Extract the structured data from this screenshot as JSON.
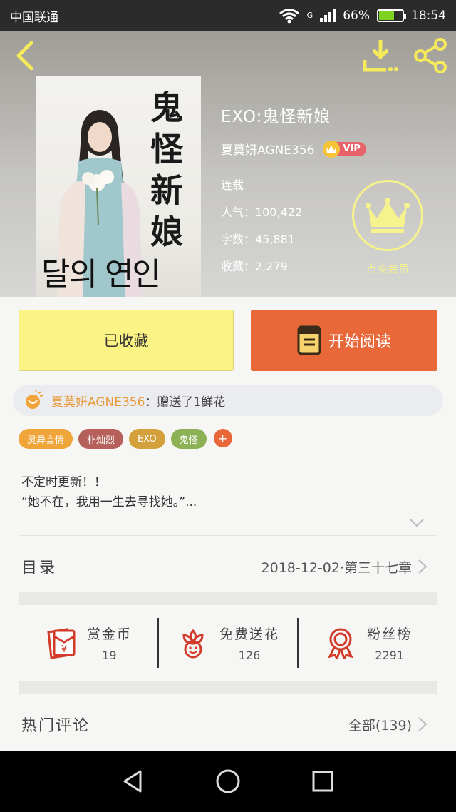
{
  "status_bar": {
    "carrier": "中国联通",
    "network": "G",
    "battery": "66%",
    "battery_level": 0.66,
    "time": "18:54"
  },
  "book": {
    "title": "EXO:鬼怪新娘",
    "author": "夏莫妍AGNE356",
    "vip_badge": "VIP",
    "status": "连载",
    "popularity": "人气：100,422",
    "word_count": "字数：45,881",
    "favorites": "收藏：2,279",
    "cover": {
      "title_chars": [
        "鬼",
        "怪",
        "新",
        "娘"
      ],
      "korean_text": "달의 연인"
    }
  },
  "member": {
    "label": "点亮会员"
  },
  "actions": {
    "collected": "已收藏",
    "start_reading": "开始阅读"
  },
  "gift": {
    "user": "夏莫妍AGNE356",
    "text": "：赠送了1鲜花"
  },
  "tags": [
    {
      "label": "灵异言情",
      "color": "#f0a53a"
    },
    {
      "label": "朴灿烈",
      "color": "#b5605a"
    },
    {
      "label": "EXO",
      "color": "#d4a03c"
    },
    {
      "label": "鬼怪",
      "color": "#8db255"
    }
  ],
  "tag_add": "+",
  "description": {
    "line1": "不定时更新！！",
    "line2": "“她不在，我用一生去寻找她。”..."
  },
  "toc": {
    "label": "目录",
    "latest": "2018-12-02·第三十七章"
  },
  "stats": [
    {
      "label": "赏金币",
      "value": "19",
      "icon": "red-envelope-icon"
    },
    {
      "label": "免费送花",
      "value": "126",
      "icon": "flower-icon"
    },
    {
      "label": "粉丝榜",
      "value": "2291",
      "icon": "medal-icon"
    }
  ],
  "comments": {
    "title": "热门评论",
    "all": "全部(139)"
  },
  "colors": {
    "accent_orange": "#e8683a",
    "collected_yellow": "#fbf383",
    "icon_red": "#d23a2a",
    "member_yellow": "#f6f28c"
  }
}
